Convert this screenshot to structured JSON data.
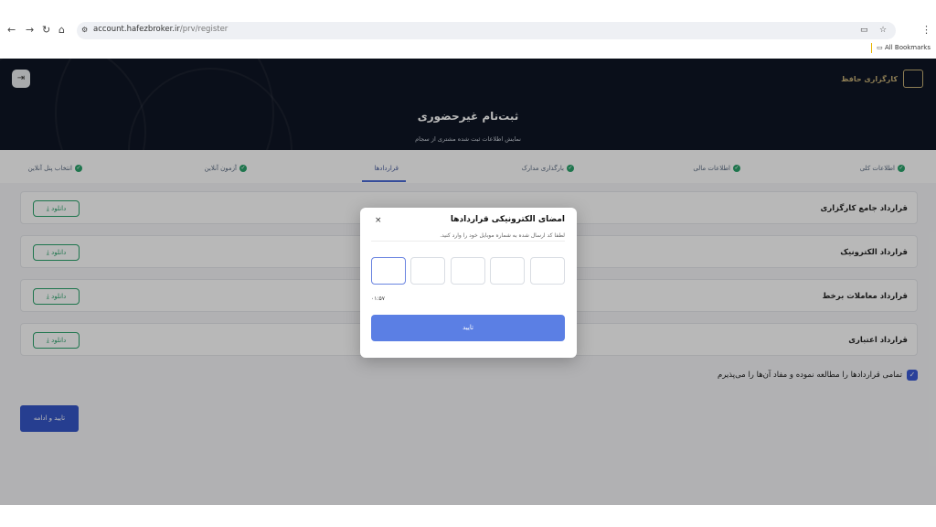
{
  "browser": {
    "url_domain": "account.hafezbroker.ir",
    "url_path": "/prv/register",
    "bookmarks_label": "All Bookmarks"
  },
  "header": {
    "logo_text": "کارگزاری حافظ",
    "title": "ثبت‌نام غیرحضوری",
    "subtitle": "نمایش اطلاعات ثبت شده مشتری از سجام"
  },
  "tabs": [
    {
      "label": "اطلاعات کلی"
    },
    {
      "label": "اطلاعات مالی"
    },
    {
      "label": "بارگذاری مدارک"
    },
    {
      "label": "قراردادها"
    },
    {
      "label": "آزمون آنلاین"
    },
    {
      "label": "انتخاب پنل آنلاین"
    }
  ],
  "contracts": [
    {
      "label": "قرارداد جامع کارگزاری",
      "download": "دانلود"
    },
    {
      "label": "قرارداد الکترونیک",
      "download": "دانلود"
    },
    {
      "label": "قرارداد معاملات برخط",
      "download": "دانلود"
    },
    {
      "label": "قرارداد اعتباری",
      "download": "دانلود"
    }
  ],
  "agreement_text": "تمامی قراردادها را مطالعه نموده و مفاد آن‌ها را می‌پذیرم",
  "continue_label": "تایید و ادامه",
  "modal": {
    "title": "امضای الکترونیکی قراردادها",
    "close": "×",
    "description": "لطفا کد ارسال شده به شماره موبایل خود را وارد کنید.",
    "timer": "۰۱:۵۷",
    "confirm_label": "تایید"
  }
}
